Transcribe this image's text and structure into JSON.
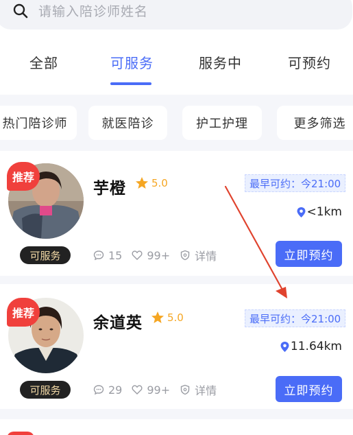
{
  "search": {
    "placeholder": "请输入陪诊师姓名"
  },
  "tabs": [
    {
      "label": "全部"
    },
    {
      "label": "可服务"
    },
    {
      "label": "服务中"
    },
    {
      "label": "可预约"
    }
  ],
  "filters": [
    {
      "label": "热门陪诊师"
    },
    {
      "label": "就医陪诊"
    },
    {
      "label": "护工护理"
    },
    {
      "label": "更多筛选"
    }
  ],
  "cards": [
    {
      "badge": "推荐",
      "name": "芋橙",
      "rating": "5.0",
      "earliest": "最早可约：今21:00",
      "distance": "<1km",
      "status": "可服务",
      "comments": "15",
      "likes": "99+",
      "detail": "详情",
      "book": "立即预约"
    },
    {
      "badge": "推荐",
      "name": "余道英",
      "rating": "5.0",
      "earliest": "最早可约：今21:00",
      "distance": "11.64km",
      "status": "可服务",
      "comments": "29",
      "likes": "99+",
      "detail": "详情",
      "book": "立即预约"
    }
  ],
  "colors": {
    "accent": "#4a6cf7",
    "badge": "#f0403c",
    "star": "#f5a623",
    "annotation_arrow": "#e0432e"
  }
}
